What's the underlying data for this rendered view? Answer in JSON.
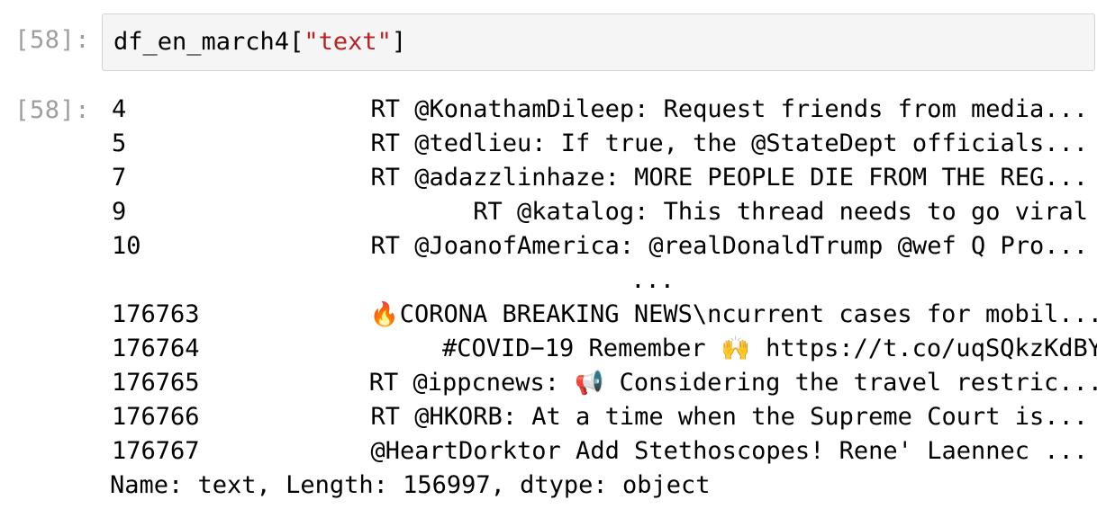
{
  "input_cell": {
    "prompt": "[58]:",
    "code_prefix": "df_en_march4[",
    "code_string": "\"text\"",
    "code_suffix": "]"
  },
  "output_cell": {
    "prompt": "[58]:",
    "rows": [
      {
        "index": "4",
        "text": "RT @KonathamDileep: Request friends from media..."
      },
      {
        "index": "5",
        "text": "RT @tedlieu: If true, the @StateDept officials..."
      },
      {
        "index": "7",
        "text": "RT @adazzlinhaze: MORE PEOPLE DIE FROM THE REG..."
      },
      {
        "index": "9",
        "text": "RT @katalog: This thread needs to go viral"
      },
      {
        "index": "10",
        "text": "RT @JoanofAmerica: @realDonaldTrump @wef Q Pro..."
      },
      {
        "index": "",
        "text": "..."
      },
      {
        "index": "176763",
        "emoji": "🔥",
        "text": "CORONA BREAKING NEWS\\ncurrent cases for mobil..."
      },
      {
        "index": "176764",
        "text_before": "#COVID−19 Remember ",
        "emoji": "🙌",
        "text_after": " https://t.co/uqSQkzKdBY"
      },
      {
        "index": "176765",
        "text_before": "RT @ippcnews: ",
        "emoji": "📢",
        "text_after": " Considering the travel restric..."
      },
      {
        "index": "176766",
        "text": "RT @HKORB: At a time when the Supreme Court is..."
      },
      {
        "index": "176767",
        "text": "@HeartDorktor Add Stethoscopes! Rene' Laennec ..."
      }
    ],
    "footer": "Name: text, Length: 156997, dtype: object"
  }
}
